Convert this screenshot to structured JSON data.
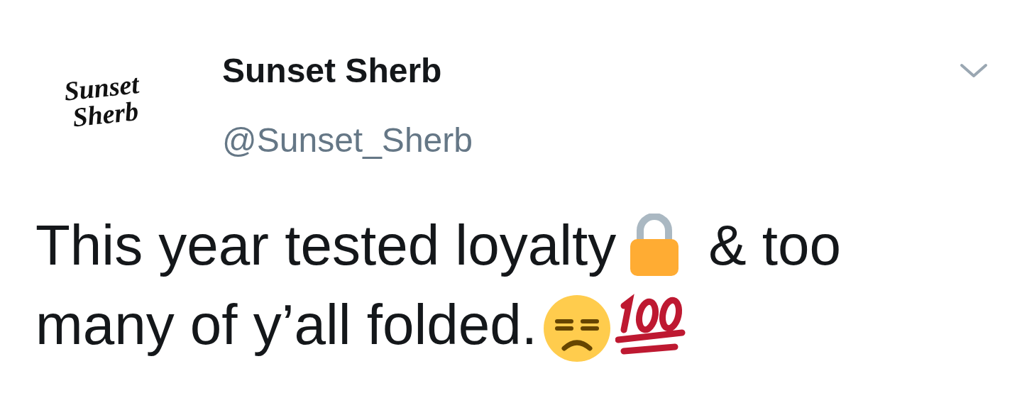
{
  "author": {
    "logo_lines": [
      "Sunset",
      "Sherb"
    ],
    "name": "Sunset Sherb",
    "handle": "@Sunset_Sherb"
  },
  "tweet_lines": [
    [
      {
        "kind": "text",
        "text": "This year tested loyalty"
      },
      {
        "kind": "lock"
      },
      {
        "kind": "text",
        "text": "& too"
      }
    ],
    [
      {
        "kind": "text",
        "text": "many of y’all folded."
      },
      {
        "kind": "unamused"
      },
      {
        "kind": "hundred"
      }
    ]
  ]
}
